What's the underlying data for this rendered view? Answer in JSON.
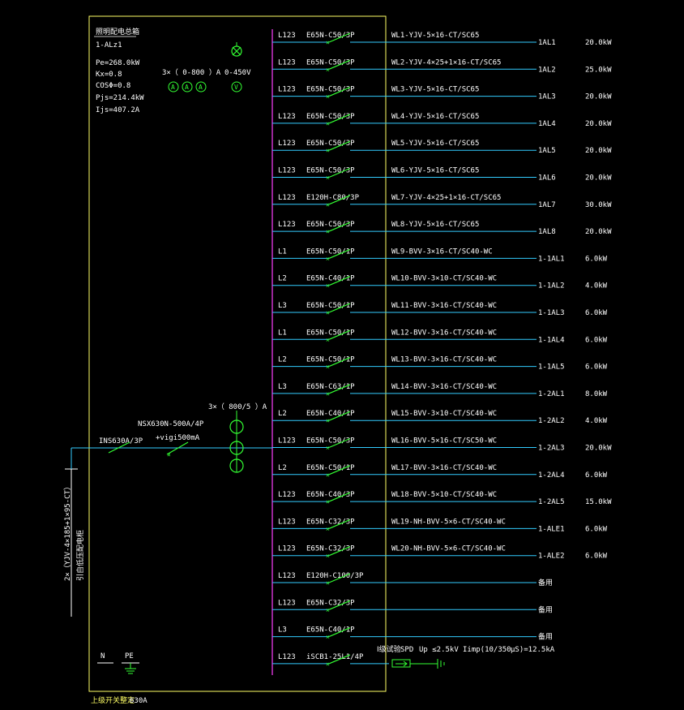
{
  "panel": {
    "title": "照明配电总箱",
    "id": "1-ALz1",
    "pe": "Pe=268.0kW",
    "kx": "Kx=0.8",
    "cos": "COSΦ=0.8",
    "pjs": "Pjs=214.4kW",
    "ijs": "Ijs=407.2A",
    "meter_ammeter": "3×（ 0-800 ）A",
    "meter_voltmeter": "0-450V",
    "ct_label": "3×（ 800/5 ）A",
    "incoming_breaker": "INS630A/3P",
    "main_breaker": "NSX630N-500A/4P",
    "main_breaker_rcd": "+vigi500mA",
    "incoming_cable": "2×（YJV-4×185+1×95-CT）",
    "incoming_source": "引自低压配电柜",
    "neutral": "N",
    "pe_bar": "PE",
    "bottom_note": "上级开关整定",
    "bottom_rating": "630A",
    "spd_label": "Ⅰ级试验",
    "spd_type": "SPD",
    "spd_up": "Up ≤2.5kV",
    "spd_iimp": "Iimp(10/350",
    "spd_ka": "μS)=12.5kA"
  },
  "circuits": [
    {
      "phase": "L123",
      "breaker": "E65N-C50/3P",
      "cable": "WL1-YJV-5×16-CT/SC65",
      "dest": "1AL1",
      "power": "20.0kW"
    },
    {
      "phase": "L123",
      "breaker": "E65N-C50/3P",
      "cable": "WL2-YJV-4×25+1×16-CT/SC65",
      "dest": "1AL2",
      "power": "25.0kW"
    },
    {
      "phase": "L123",
      "breaker": "E65N-C50/3P",
      "cable": "WL3-YJV-5×16-CT/SC65",
      "dest": "1AL3",
      "power": "20.0kW"
    },
    {
      "phase": "L123",
      "breaker": "E65N-C50/3P",
      "cable": "WL4-YJV-5×16-CT/SC65",
      "dest": "1AL4",
      "power": "20.0kW"
    },
    {
      "phase": "L123",
      "breaker": "E65N-C50/3P",
      "cable": "WL5-YJV-5×16-CT/SC65",
      "dest": "1AL5",
      "power": "20.0kW"
    },
    {
      "phase": "L123",
      "breaker": "E65N-C50/3P",
      "cable": "WL6-YJV-5×16-CT/SC65",
      "dest": "1AL6",
      "power": "20.0kW"
    },
    {
      "phase": "L123",
      "breaker": "E120H-C80/3P",
      "cable": "WL7-YJV-4×25+1×16-CT/SC65",
      "dest": "1AL7",
      "power": "30.0kW"
    },
    {
      "phase": "L123",
      "breaker": "E65N-C50/3P",
      "cable": "WL8-YJV-5×16-CT/SC65",
      "dest": "1AL8",
      "power": "20.0kW"
    },
    {
      "phase": "L1",
      "breaker": "E65N-C50/1P",
      "cable": "WL9-BVV-3×16-CT/SC40-WC",
      "dest": "1-1AL1",
      "power": "6.0kW"
    },
    {
      "phase": "L2",
      "breaker": "E65N-C40/1P",
      "cable": "WL10-BVV-3×10-CT/SC40-WC",
      "dest": "1-1AL2",
      "power": "4.0kW"
    },
    {
      "phase": "L3",
      "breaker": "E65N-C50/1P",
      "cable": "WL11-BVV-3×16-CT/SC40-WC",
      "dest": "1-1AL3",
      "power": "6.0kW"
    },
    {
      "phase": "L1",
      "breaker": "E65N-C50/1P",
      "cable": "WL12-BVV-3×16-CT/SC40-WC",
      "dest": "1-1AL4",
      "power": "6.0kW"
    },
    {
      "phase": "L2",
      "breaker": "E65N-C50/1P",
      "cable": "WL13-BVV-3×16-CT/SC40-WC",
      "dest": "1-1AL5",
      "power": "6.0kW"
    },
    {
      "phase": "L3",
      "breaker": "E65N-C63/1P",
      "cable": "WL14-BVV-3×16-CT/SC40-WC",
      "dest": "1-2AL1",
      "power": "8.0kW"
    },
    {
      "phase": "L2",
      "breaker": "E65N-C40/1P",
      "cable": "WL15-BVV-3×10-CT/SC40-WC",
      "dest": "1-2AL2",
      "power": "4.0kW"
    },
    {
      "phase": "L123",
      "breaker": "E65N-C50/3P",
      "cable": "WL16-BVV-5×16-CT/SC50-WC",
      "dest": "1-2AL3",
      "power": "20.0kW"
    },
    {
      "phase": "L2",
      "breaker": "E65N-C50/1P",
      "cable": "WL17-BVV-3×16-CT/SC40-WC",
      "dest": "1-2AL4",
      "power": "6.0kW"
    },
    {
      "phase": "L123",
      "breaker": "E65N-C40/3P",
      "cable": "WL18-BVV-5×10-CT/SC40-WC",
      "dest": "1-2AL5",
      "power": "15.0kW"
    },
    {
      "phase": "L123",
      "breaker": "E65N-C32/3P",
      "cable": "WL19-NH-BVV-5×6-CT/SC40-WC",
      "dest": "1-ALE1",
      "power": "6.0kW"
    },
    {
      "phase": "L123",
      "breaker": "E65N-C32/3P",
      "cable": "WL20-NH-BVV-5×6-CT/SC40-WC",
      "dest": "1-ALE2",
      "power": "6.0kW"
    },
    {
      "phase": "L123",
      "breaker": "E120H-C100/3P",
      "cable": "",
      "dest": "备用",
      "power": ""
    },
    {
      "phase": "L123",
      "breaker": "E65N-C32/3P",
      "cable": "",
      "dest": "备用",
      "power": ""
    },
    {
      "phase": "L3",
      "breaker": "E65N-C40/1P",
      "cable": "",
      "dest": "备用",
      "power": ""
    },
    {
      "phase": "L123",
      "breaker": "iSCB1-25L1/4P",
      "cable": "",
      "dest": "",
      "power": ""
    }
  ],
  "colors": {
    "background": "#000000",
    "frame": "#ffff66",
    "busbar": "#cc33cc",
    "feeder": "#33ccff",
    "breaker": "#33ff33",
    "text": "#ffffff"
  }
}
